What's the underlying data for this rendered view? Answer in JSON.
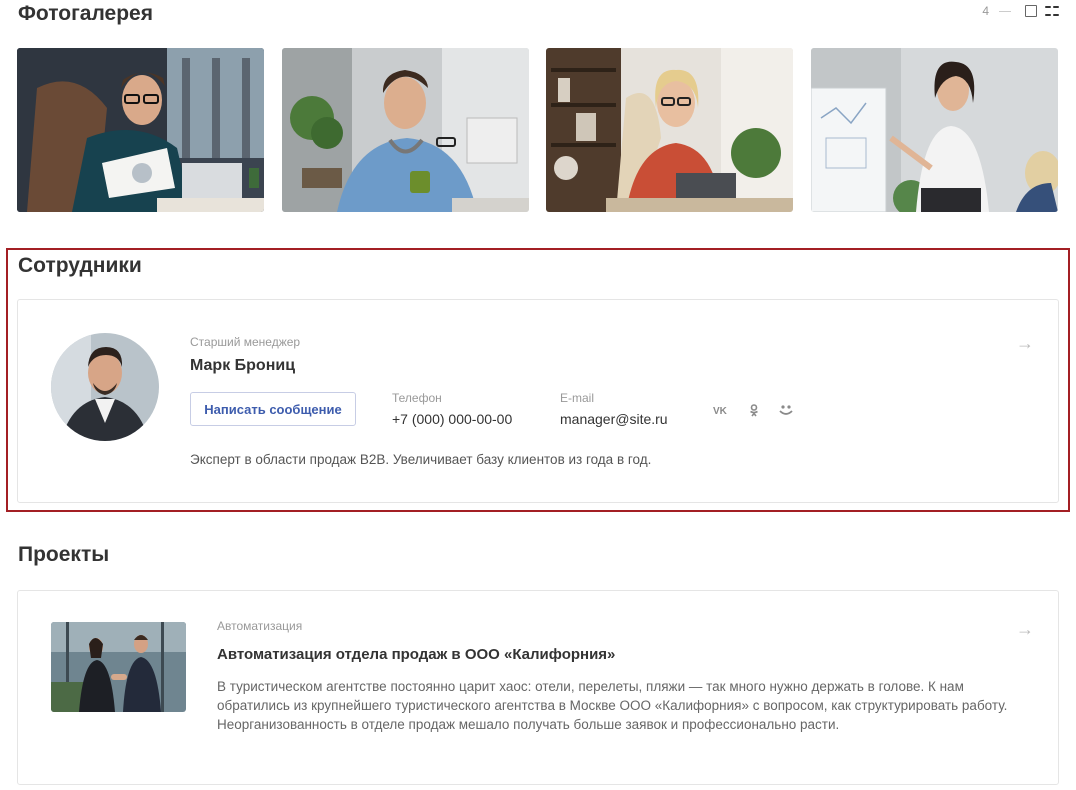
{
  "gallery": {
    "title": "Фотогалерея",
    "count": "4",
    "view_single_icon": "square-icon",
    "view_grid_icon": "grid-icon",
    "photos": [
      "photo-businessman-with-chart",
      "photo-man-with-mug",
      "photo-woman-on-phone",
      "photo-woman-at-whiteboard"
    ]
  },
  "employees": {
    "title": "Сотрудники",
    "card": {
      "role": "Старший менеджер",
      "name": "Марк Брониц",
      "write_button": "Написать сообщение",
      "phone_label": "Телефон",
      "phone": "+7 (000) 000-00-00",
      "email_label": "E-mail",
      "email": "manager@site.ru",
      "socials": [
        "vk-icon",
        "odnoklassniki-icon",
        "moimir-icon"
      ],
      "description": "Эксперт в области продаж B2B. Увеличивает базу клиентов из года в год.",
      "arrow": "→"
    }
  },
  "projects": {
    "title": "Проекты",
    "item": {
      "category": "Автоматизация",
      "title": "Автоматизация отдела продаж в ООО «Калифорния»",
      "text": "В туристическом агентстве постоянно царит хаос: отели, перелеты, пляжи — так много нужно держать в голове. К нам обратились из крупнейшего туристического агентства в Москве ООО «Калифорния» с вопросом, как структурировать работу. Неорганизованность в отделе продаж мешало получать больше заявок и профессионально расти.",
      "arrow": "→"
    }
  },
  "colors": {
    "accent": "#3d5cad",
    "highlight_frame": "#a31f24",
    "text": "#333333",
    "muted": "#999999"
  }
}
